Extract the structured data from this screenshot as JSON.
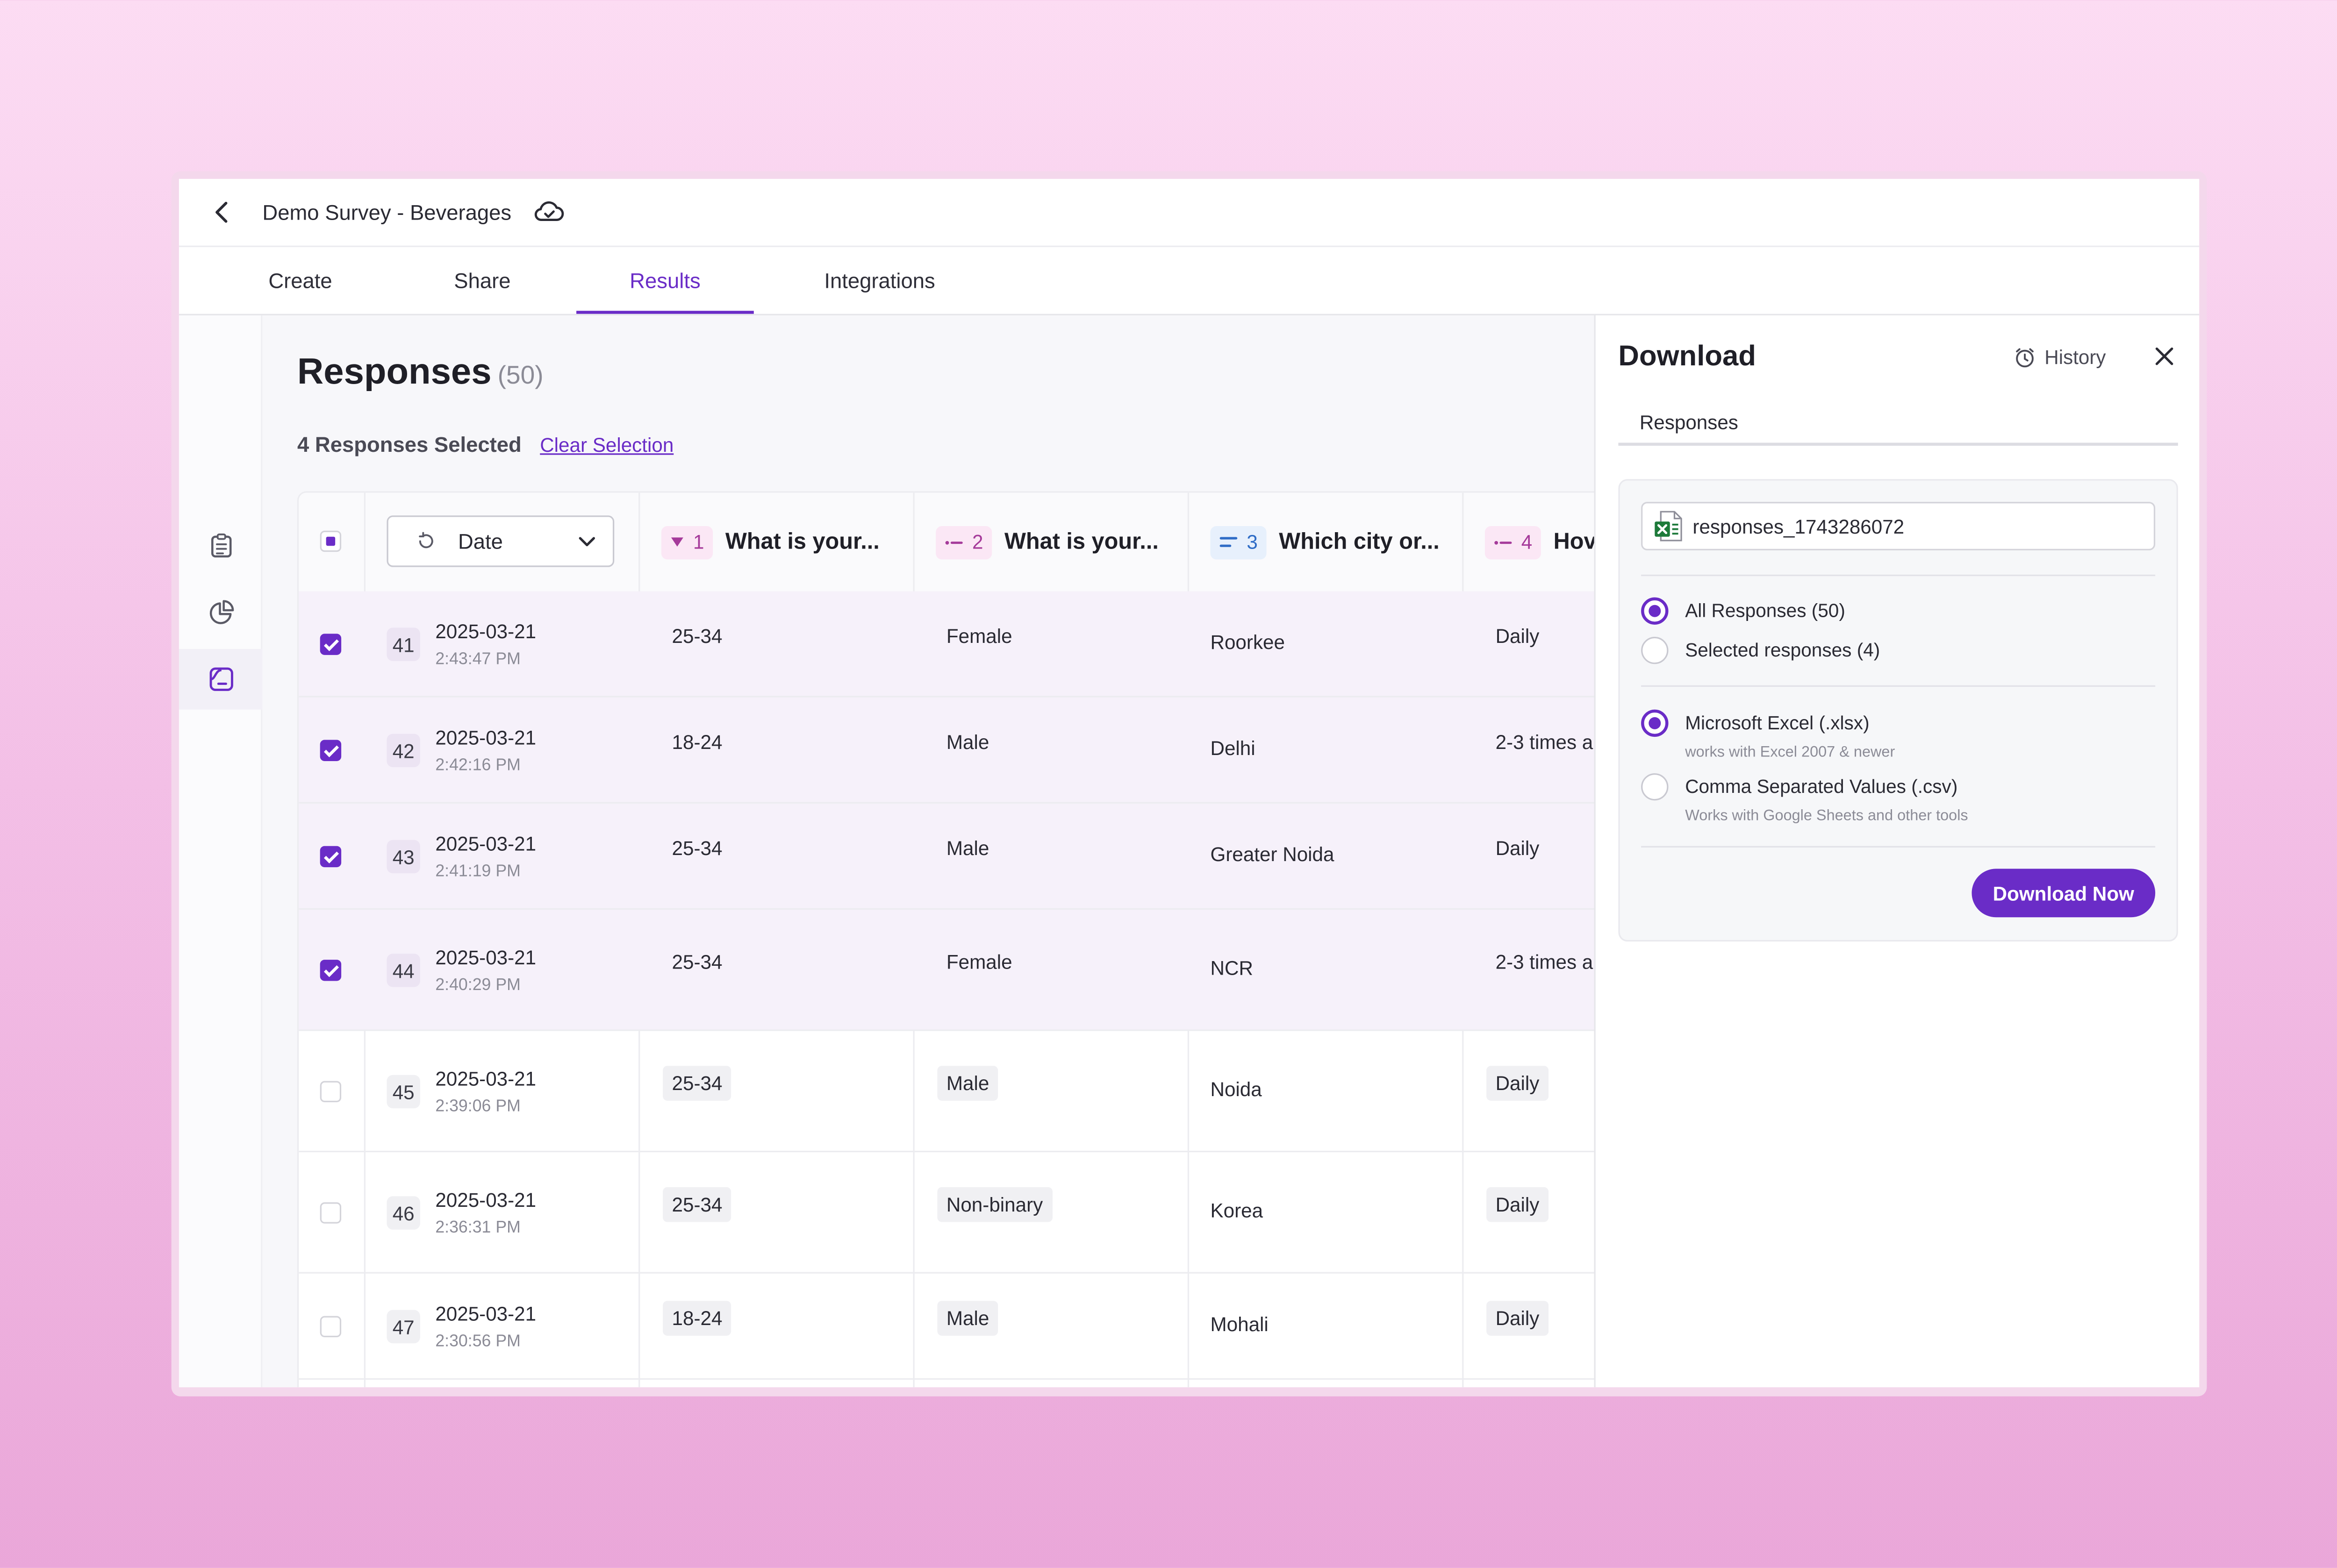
{
  "header": {
    "title": "Demo Survey - Beverages"
  },
  "tabs": [
    {
      "label": "Create"
    },
    {
      "label": "Share"
    },
    {
      "label": "Results"
    },
    {
      "label": "Integrations"
    }
  ],
  "responses": {
    "title": "Responses",
    "count": "(50)",
    "selected_text": "4 Responses Selected",
    "clear_label": "Clear Selection"
  },
  "table": {
    "date_label": "Date",
    "columns": [
      {
        "num": "1",
        "text": "What is your..."
      },
      {
        "num": "2",
        "text": "What is your..."
      },
      {
        "num": "3",
        "text": "Which city or..."
      },
      {
        "num": "4",
        "text": "Hov"
      }
    ],
    "rows": [
      {
        "id": "41",
        "date": "2025-03-21",
        "time": "2:43:47 PM",
        "c1": "25-34",
        "c2": "Female",
        "c3": "Roorkee",
        "c4": "Daily"
      },
      {
        "id": "42",
        "date": "2025-03-21",
        "time": "2:42:16 PM",
        "c1": "18-24",
        "c2": "Male",
        "c3": "Delhi",
        "c4": "2-3 times a"
      },
      {
        "id": "43",
        "date": "2025-03-21",
        "time": "2:41:19 PM",
        "c1": "25-34",
        "c2": "Male",
        "c3": "Greater Noida",
        "c4": "Daily"
      },
      {
        "id": "44",
        "date": "2025-03-21",
        "time": "2:40:29 PM",
        "c1": "25-34",
        "c2": "Female",
        "c3": "NCR",
        "c4": "2-3 times a"
      },
      {
        "id": "45",
        "date": "2025-03-21",
        "time": "2:39:06 PM",
        "c1": "25-34",
        "c2": "Male",
        "c3": "Noida",
        "c4": "Daily"
      },
      {
        "id": "46",
        "date": "2025-03-21",
        "time": "2:36:31 PM",
        "c1": "25-34",
        "c2": "Non-binary",
        "c3": "Korea",
        "c4": "Daily"
      },
      {
        "id": "47",
        "date": "2025-03-21",
        "time": "2:30:56 PM",
        "c1": "18-24",
        "c2": "Male",
        "c3": "Mohali",
        "c4": "Daily"
      }
    ]
  },
  "download": {
    "title": "Download",
    "history_label": "History",
    "subtitle": "Responses",
    "filename": "responses_1743286072",
    "scope_all": "All Responses (50)",
    "scope_selected": "Selected responses (4)",
    "fmt_xlsx": "Microsoft Excel (.xlsx)",
    "fmt_xlsx_hint": "works with Excel 2007 & newer",
    "fmt_csv": "Comma Separated Values (.csv)",
    "fmt_csv_hint": "Works with Google Sheets and other tools",
    "button_label": "Download Now"
  },
  "colors": {
    "accent": "#6a2cc7",
    "selected_row": "#f6f1fa",
    "tag_pink": "#fbe7f5",
    "tag_blue": "#e7f0fc",
    "excel_green": "#1d7a3a"
  },
  "icons": [
    "chevron-left-icon",
    "cloud-check-icon",
    "clipboard-icon",
    "pie-chart-icon",
    "responses-icon",
    "refresh-icon",
    "chevron-down-icon",
    "dropdown-question-icon",
    "text-question-icon",
    "clock-icon",
    "close-icon",
    "excel-file-icon"
  ]
}
